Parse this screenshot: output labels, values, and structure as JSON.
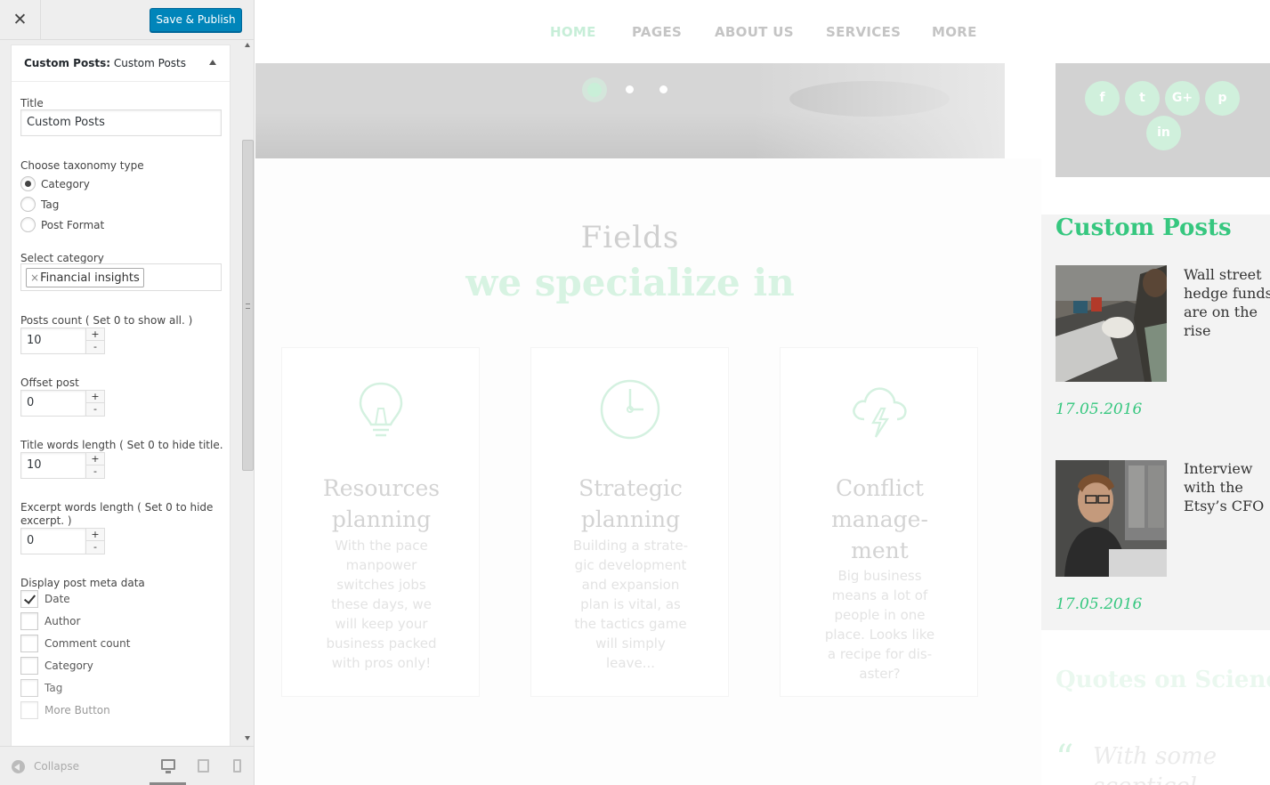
{
  "customizer": {
    "close_label": "✕",
    "save_button": "Save & Publish",
    "section_prefix": "Custom Posts:",
    "section_name": "Custom Posts",
    "title_label": "Title",
    "title_value": "Custom Posts",
    "taxonomy_label": "Choose taxonomy type",
    "taxonomy_options": [
      {
        "label": "Category",
        "checked": true
      },
      {
        "label": "Tag",
        "checked": false
      },
      {
        "label": "Post Format",
        "checked": false
      }
    ],
    "category_label": "Select category",
    "category_chip_x": "×",
    "category_selected": "Financial insights",
    "posts_count_label": "Posts count ( Set 0 to show all. )",
    "posts_count_value": "10",
    "offset_label": "Offset post",
    "offset_value": "0",
    "title_words_label": "Title words length ( Set 0 to hide title. )",
    "title_words_value": "10",
    "excerpt_label_line1": "Excerpt words length ( Set 0 to hide",
    "excerpt_label_line2": "excerpt. )",
    "excerpt_value": "0",
    "stepper_plus": "+",
    "stepper_minus": "-",
    "meta_label": "Display post meta data",
    "meta_options": [
      {
        "label": "Date",
        "checked": true
      },
      {
        "label": "Author",
        "checked": false
      },
      {
        "label": "Comment count",
        "checked": false
      },
      {
        "label": "Category",
        "checked": false
      },
      {
        "label": "Tag",
        "checked": false
      },
      {
        "label": "More Button",
        "checked": false
      }
    ],
    "collapse_label": "Collapse"
  },
  "preview": {
    "nav": [
      {
        "label": "HOME",
        "active": true
      },
      {
        "label": "PAGES",
        "active": false
      },
      {
        "label": "ABOUT US",
        "active": false
      },
      {
        "label": "SERVICES",
        "active": false
      },
      {
        "label": "MORE",
        "active": false
      }
    ],
    "heading_line1": "Fields",
    "heading_line2": "we specialize in",
    "cards": [
      {
        "icon": "lightbulb-icon",
        "title_line1": "Resources",
        "title_line2": "planning",
        "title_line3": "",
        "text": [
          "With the pace",
          "manpower",
          "switches jobs",
          "these days, we",
          "will keep your",
          "business packed",
          "with pros only!"
        ]
      },
      {
        "icon": "clock-icon",
        "title_line1": "Strategic",
        "title_line2": "planning",
        "title_line3": "",
        "text": [
          "Building a strate-",
          "gic development",
          "and expansion",
          "plan is vital, as",
          "the tactics game",
          "will simply",
          "leave..."
        ]
      },
      {
        "icon": "storm-cloud-icon",
        "title_line1": "Conflict",
        "title_line2": "manage-",
        "title_line3": "ment",
        "text": [
          "Big business",
          "means a lot of",
          "people in one",
          "place. Looks like",
          "a recipe for dis-",
          "aster?"
        ]
      }
    ],
    "social": [
      {
        "icon": "facebook-icon",
        "glyph": "f"
      },
      {
        "icon": "twitter-icon",
        "glyph": "t"
      },
      {
        "icon": "google-plus-icon",
        "glyph": "G+"
      },
      {
        "icon": "pinterest-icon",
        "glyph": "p"
      },
      {
        "icon": "linkedin-icon",
        "glyph": "in"
      }
    ],
    "widget_title": "Custom Posts",
    "posts": [
      {
        "title": [
          "Wall street",
          "hedge funds",
          "are on the",
          "rise"
        ],
        "date": "17.05.2016"
      },
      {
        "title": [
          "Interview",
          "with the",
          "Etsy’s CFO"
        ],
        "date": "17.05.2016"
      }
    ],
    "quotes_title": "Quotes on Science",
    "quote_mark": "“",
    "quote_text_line1": "With some",
    "quote_text_line2": "scepticel"
  },
  "colors": {
    "accent_green": "#36c77f",
    "save_blue": "#0085ba"
  }
}
